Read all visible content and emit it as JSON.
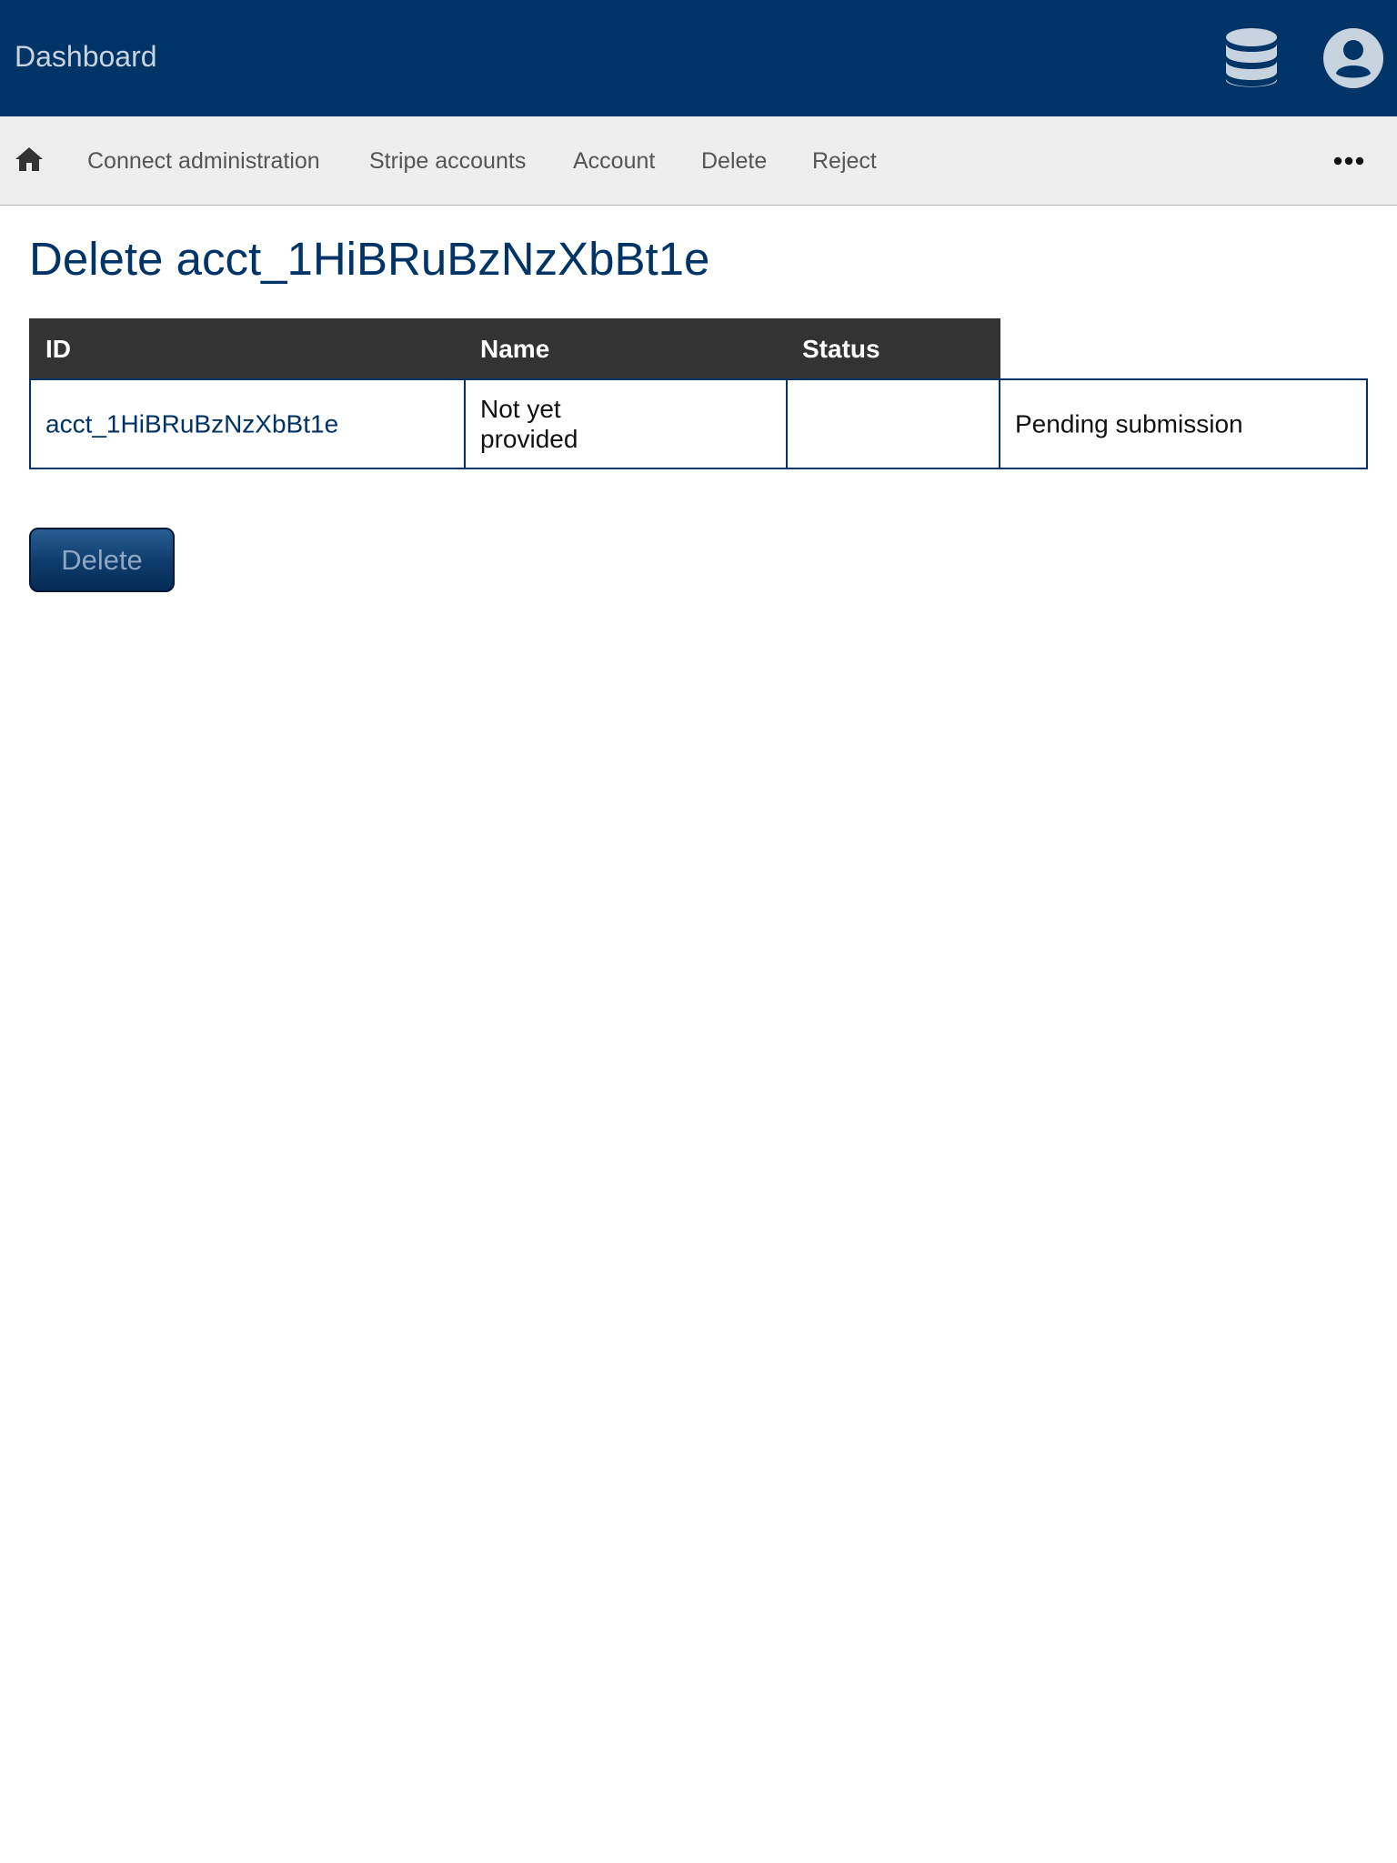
{
  "header": {
    "title": "Dashboard",
    "icons": [
      "database-icon",
      "user-account-icon"
    ],
    "background_color": "#003366"
  },
  "nav": {
    "home_icon": "home-icon",
    "items": [
      {
        "label": "Connect administration"
      },
      {
        "label": "Stripe accounts"
      },
      {
        "label": "Account"
      },
      {
        "label": "Delete"
      },
      {
        "label": "Reject"
      }
    ],
    "more_icon": "more-horizontal-icon"
  },
  "main": {
    "title": "Delete acct_1HiBRuBzNzXbBt1e",
    "table": {
      "headers": [
        "ID",
        "Name",
        "Status"
      ],
      "rows": [
        {
          "id": "acct_1HiBRuBzNzXbBt1e",
          "name_line1": "Not yet",
          "name_line2": "provided",
          "empty": "",
          "status": "Pending submission"
        }
      ]
    },
    "delete_button_label": "Delete"
  },
  "colors": {
    "accent": "#003366",
    "table_header": "#333333",
    "nav_background": "#eeeeee"
  }
}
